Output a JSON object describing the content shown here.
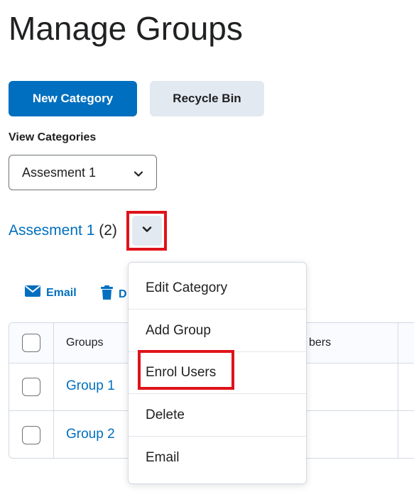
{
  "page": {
    "title": "Manage Groups"
  },
  "toolbar": {
    "new_category": "New Category",
    "recycle_bin": "Recycle Bin"
  },
  "view": {
    "label": "View Categories",
    "selected": "Assesment 1"
  },
  "category": {
    "name": "Assesment 1",
    "count": "(2)"
  },
  "actions": {
    "email": "Email",
    "delete_partial": "D"
  },
  "table": {
    "header_groups": "Groups",
    "header_members_partial": "bers",
    "rows": [
      {
        "name": "Group 1"
      },
      {
        "name": "Group 2"
      }
    ]
  },
  "menu": {
    "items": [
      "Edit Category",
      "Add Group",
      "Enrol Users",
      "Delete",
      "Email"
    ]
  },
  "colors": {
    "accent": "#006fbf",
    "highlight": "#e0121a",
    "secondary_bg": "#e3e9f1"
  }
}
